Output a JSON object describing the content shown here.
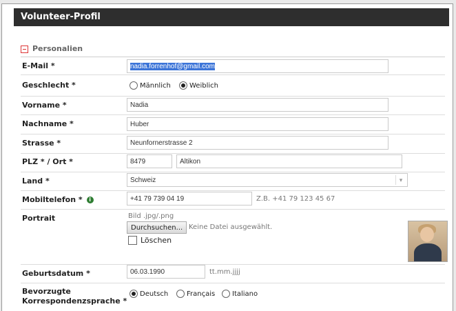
{
  "title": "Volunteer-Profil",
  "section": {
    "label": "Personalien"
  },
  "email": {
    "label": "E-Mail *",
    "value": "nadia.forrenhof@gmail.com"
  },
  "gender": {
    "label": "Geschlecht *",
    "options": [
      "Männlich",
      "Weiblich"
    ],
    "selected": "Weiblich"
  },
  "first_name": {
    "label": "Vorname *",
    "value": "Nadia"
  },
  "last_name": {
    "label": "Nachname *",
    "value": "Huber"
  },
  "street": {
    "label": "Strasse *",
    "value": "Neunfornerstrasse 2"
  },
  "zip_city": {
    "label": "PLZ * / Ort *",
    "zip": "8479",
    "city": "Altikon"
  },
  "country": {
    "label": "Land *",
    "value": "Schweiz"
  },
  "mobile": {
    "label": "Mobiltelefon *",
    "value": "+41 79 739 04 19",
    "hint": "Z.B. +41 79 123 45 67"
  },
  "portrait": {
    "label": "Portrait",
    "hint": "Bild .jpg/.png",
    "browse_label": "Durchsuchen...",
    "no_file": "Keine Datei ausgewählt.",
    "delete_label": "Löschen"
  },
  "birthdate": {
    "label": "Geburtsdatum *",
    "value": "06.03.1990",
    "hint": "tt.mm.jjjj"
  },
  "language": {
    "label_line1": "Bevorzugte",
    "label_line2": "Korrespondenzsprache *",
    "options": [
      "Deutsch",
      "Français",
      "Italiano"
    ],
    "selected": "Deutsch"
  },
  "colors": {
    "header_bg": "#2e2e2e",
    "selection": "#3b74d8",
    "section_icon": "#dd3333",
    "info_icon": "#2e7d32"
  }
}
